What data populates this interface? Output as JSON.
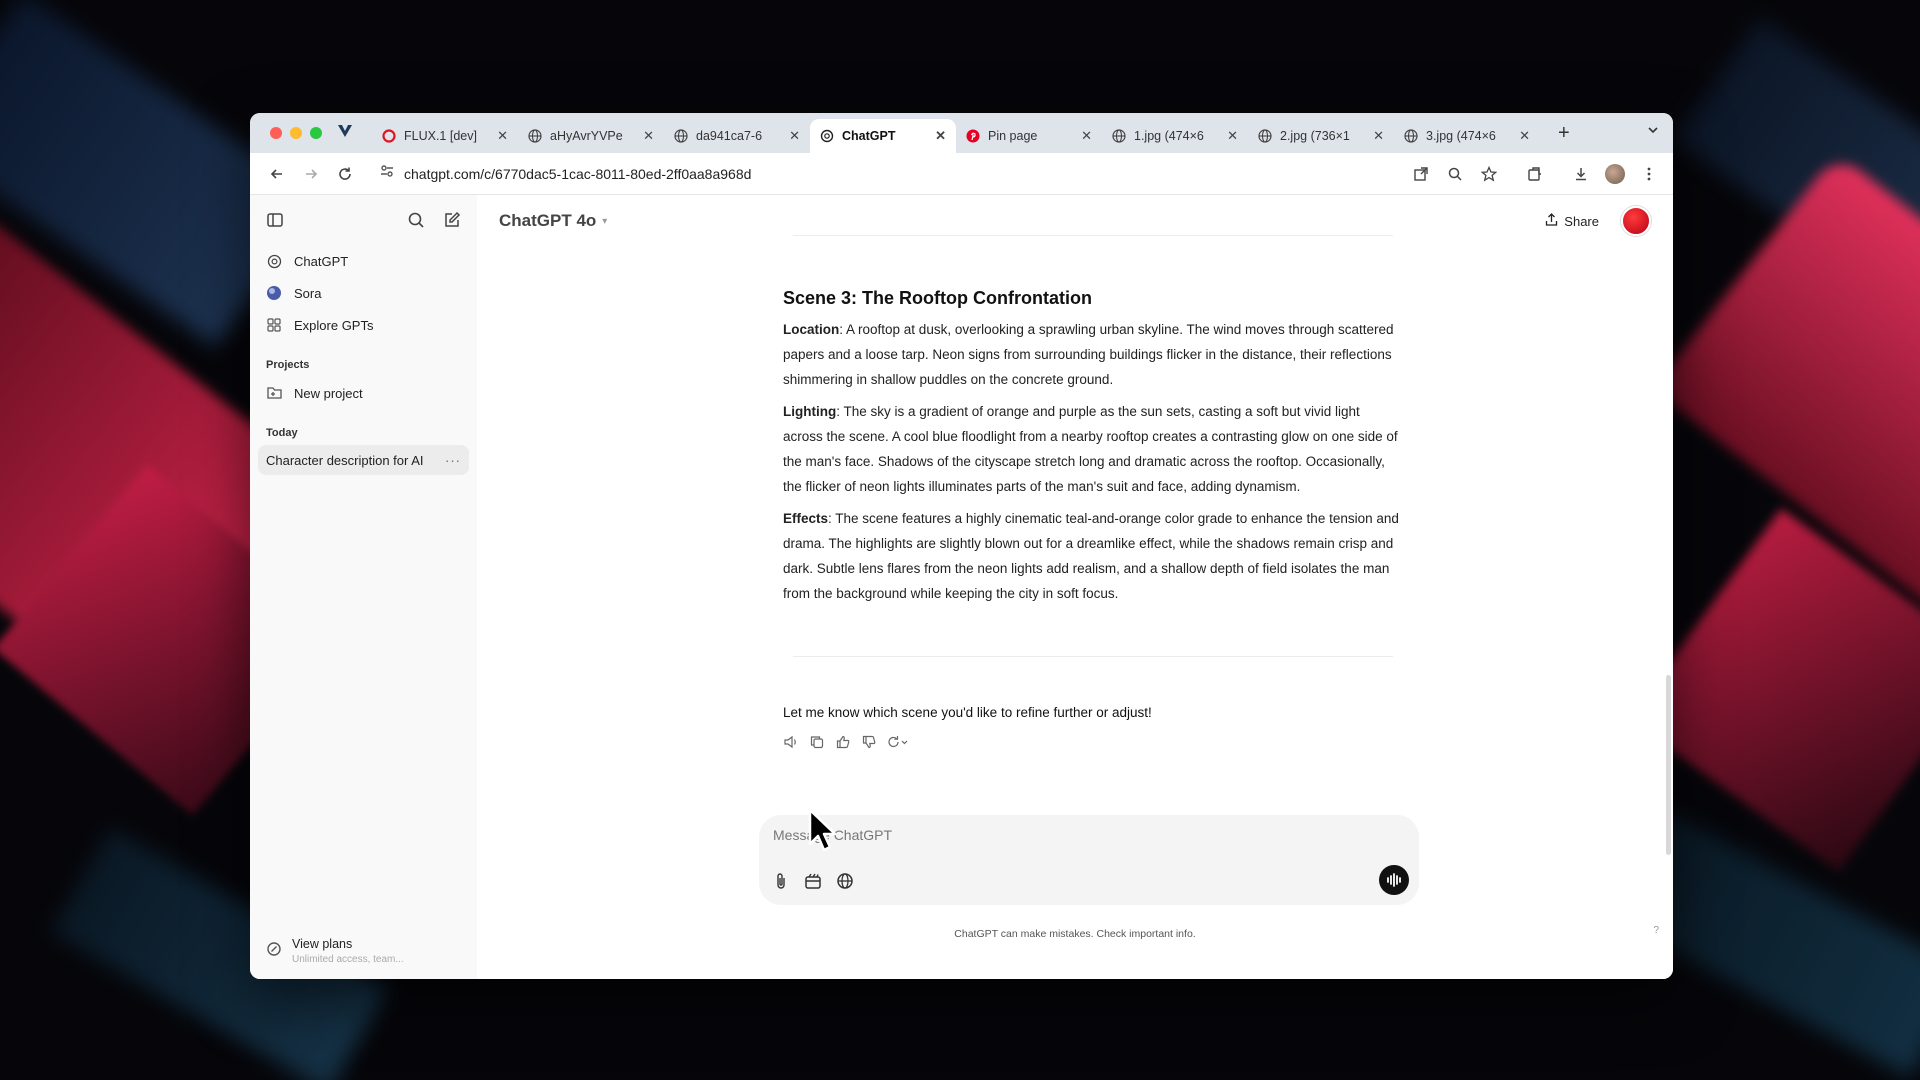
{
  "browser": {
    "tabs": [
      {
        "title": "FLUX.1 [dev]",
        "icon": "replicate-icon",
        "active": false
      },
      {
        "title": "aHyAvrYVPe",
        "icon": "globe-icon",
        "active": false
      },
      {
        "title": "da941ca7-6",
        "icon": "globe-icon",
        "active": false
      },
      {
        "title": "ChatGPT",
        "icon": "chatgpt-icon",
        "active": true
      },
      {
        "title": "Pin page",
        "icon": "pinterest-icon",
        "active": false
      },
      {
        "title": "1.jpg (474×6",
        "icon": "globe-icon",
        "active": false
      },
      {
        "title": "2.jpg (736×1",
        "icon": "globe-icon",
        "active": false
      },
      {
        "title": "3.jpg (474×6",
        "icon": "globe-icon",
        "active": false
      }
    ],
    "new_tab": "+",
    "url": "chatgpt.com/c/6770dac5-1cac-8011-80ed-2ff0aa8a968d"
  },
  "sidebar": {
    "items": [
      {
        "label": "ChatGPT",
        "icon": "chatgpt-icon"
      },
      {
        "label": "Sora",
        "icon": "sora-icon"
      },
      {
        "label": "Explore GPTs",
        "icon": "grid-icon"
      }
    ],
    "projects_heading": "Projects",
    "new_project": "New project",
    "today_heading": "Today",
    "conversation": "Character description for AI",
    "conversation_menu": "···",
    "view_plans": "View plans",
    "view_plans_sub": "Unlimited access, team..."
  },
  "header": {
    "model": "ChatGPT 4o",
    "share": "Share"
  },
  "message": {
    "scene_title": "Scene 3: The Rooftop Confrontation",
    "location_label": "Location",
    "location_text": ": A rooftop at dusk, overlooking a sprawling urban skyline. The wind moves through scattered papers and a loose tarp. Neon signs from surrounding buildings flicker in the distance, their reflections shimmering in shallow puddles on the concrete ground.",
    "lighting_label": "Lighting",
    "lighting_text": ": The sky is a gradient of orange and purple as the sun sets, casting a soft but vivid light across the scene. A cool blue floodlight from a nearby rooftop creates a contrasting glow on one side of the man's face. Shadows of the cityscape stretch long and dramatic across the rooftop. Occasionally, the flicker of neon lights illuminates parts of the man's suit and face, adding dynamism.",
    "effects_label": "Effects",
    "effects_text": ": The scene features a highly cinematic teal-and-orange color grade to enhance the tension and drama. The highlights are slightly blown out for a dreamlike effect, while the shadows remain crisp and dark. Subtle lens flares from the neon lights add realism, and a shallow depth of field isolates the man from the background while keeping the city in soft focus.",
    "closing": "Let me know which scene you'd like to refine further or adjust!"
  },
  "composer": {
    "placeholder": "Message ChatGPT"
  },
  "disclaimer": "ChatGPT can make mistakes. Check important info.",
  "help": "?",
  "colors": {
    "accent_avatar": "#e0141e",
    "wallpaper_red": "#d8264e",
    "tab_bar": "#dfe3ea"
  }
}
